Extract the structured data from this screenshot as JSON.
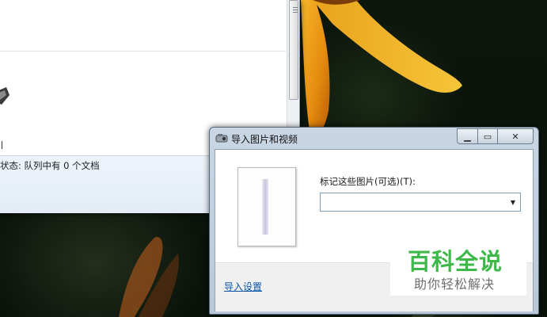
{
  "print_queue_window": {
    "status_text": "状态: 队列中有 0 个文档"
  },
  "import_dialog": {
    "title": "导入图片和视频",
    "tag_label": "标记这些图片(可选)(T):",
    "tag_value": "",
    "import_settings_link": "导入设置",
    "caption_buttons": {
      "minimize": "▁",
      "maximize": "▭",
      "close": "✕"
    },
    "dropdown_arrow": "▼"
  },
  "watermark": {
    "title": "百科全说",
    "subtitle": "助你轻松解决"
  },
  "colors": {
    "link": "#0a56a8",
    "watermark_green": "#3fb84a",
    "flower_orange": "#f2a11a"
  }
}
